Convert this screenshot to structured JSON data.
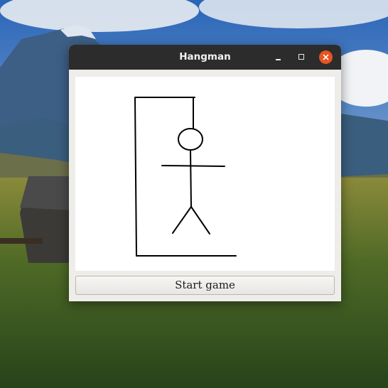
{
  "window": {
    "title": "Hangman"
  },
  "controls": {
    "start_label": "Start game"
  },
  "colors": {
    "titlebar": "#2c2c2c",
    "close_button": "#e95420",
    "window_bg": "#efede9",
    "canvas_bg": "#ffffff"
  },
  "icons": [
    "minimize-icon",
    "maximize-icon",
    "close-icon"
  ]
}
